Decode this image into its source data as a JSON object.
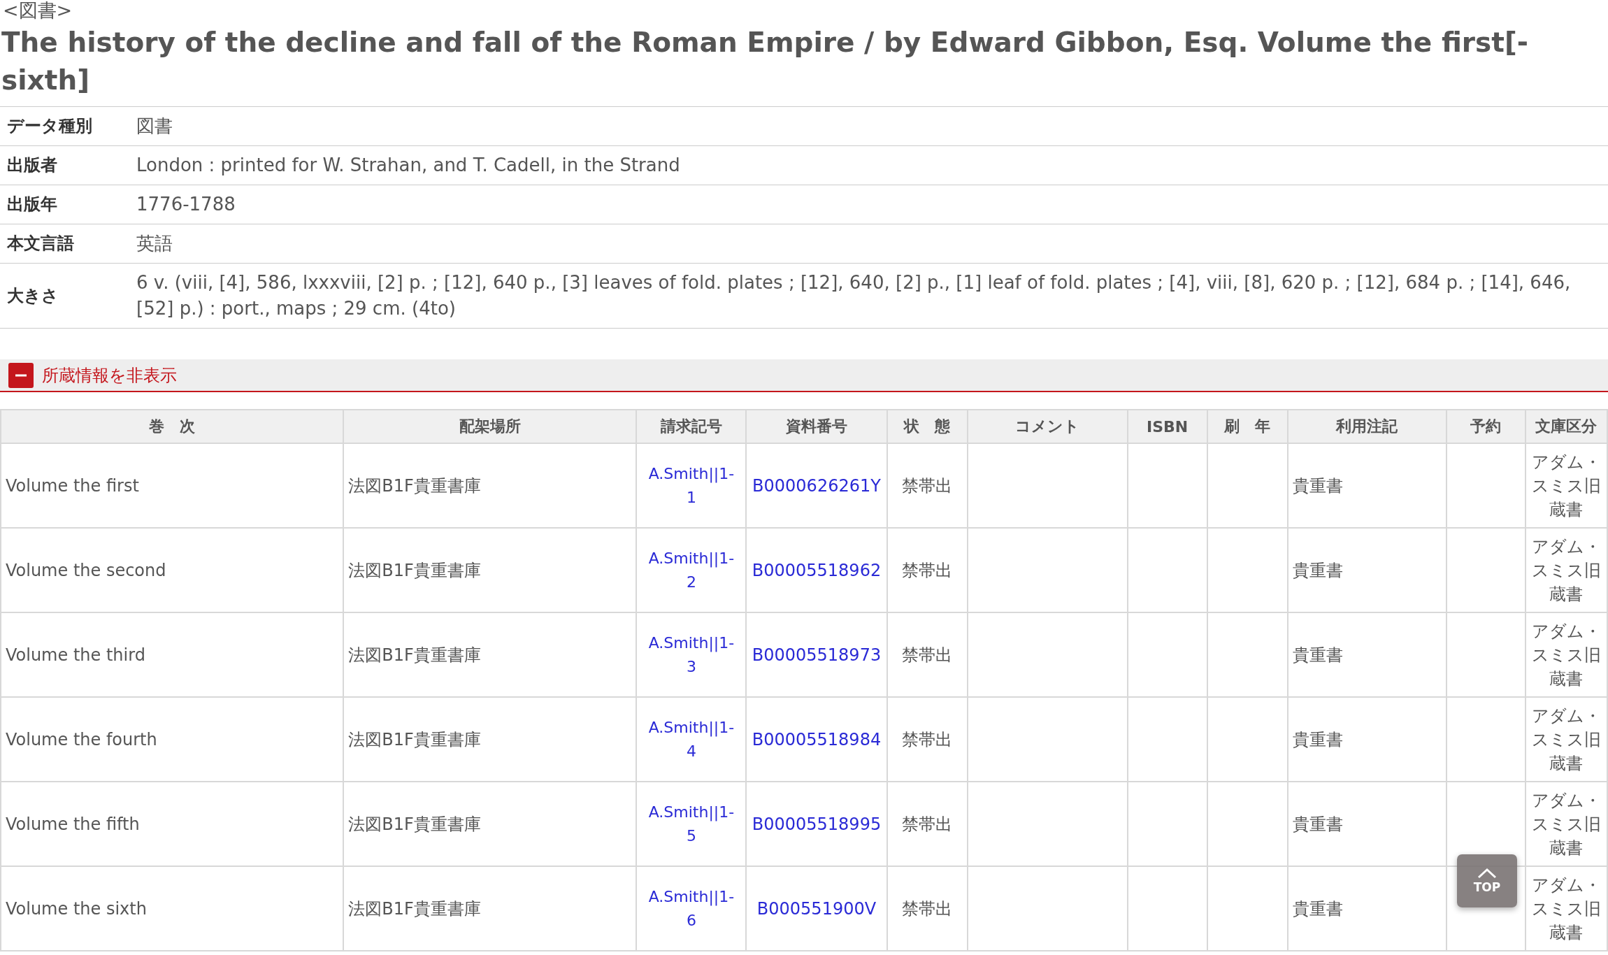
{
  "category_label": "<図書>",
  "title": "The history of the decline and fall of the Roman Empire / by Edward Gibbon, Esq. Volume the first[-sixth]",
  "details": [
    {
      "label": "データ種別",
      "value": "図書"
    },
    {
      "label": "出版者",
      "value": "London : printed for W. Strahan, and T. Cadell, in the Strand"
    },
    {
      "label": "出版年",
      "value": "1776-1788"
    },
    {
      "label": "本文言語",
      "value": "英語"
    },
    {
      "label": "大きさ",
      "value": "6 v. (viii, [4], 586, lxxxviii, [2] p. ; [12], 640 p., [3] leaves of fold. plates ; [12], 640, [2] p., [1] leaf of fold. plates ; [4], viii, [8], 620 p. ; [12], 684 p. ; [14], 646, [52] p.) : port., maps ; 29 cm. (4to)"
    }
  ],
  "holdings_toggle": {
    "label": "所蔵情報を非表示",
    "expanded": true
  },
  "holdings_table": {
    "columns": [
      "巻　次",
      "配架場所",
      "請求記号",
      "資料番号",
      "状　態",
      "コメント",
      "ISBN",
      "刷　年",
      "利用注記",
      "予約",
      "文庫区分"
    ],
    "rows": [
      {
        "volume": "Volume the first",
        "location": "法図B1F貴重書庫",
        "call_number": "A.Smith||1-1",
        "item_number": "B0000626261Y",
        "status": "禁帯出",
        "usage_note": "貴重書",
        "collection": "アダム・スミス旧蔵書"
      },
      {
        "volume": "Volume the second",
        "location": "法図B1F貴重書庫",
        "call_number": "A.Smith||1-2",
        "item_number": "B00005518962",
        "status": "禁帯出",
        "usage_note": "貴重書",
        "collection": "アダム・スミス旧蔵書"
      },
      {
        "volume": "Volume the third",
        "location": "法図B1F貴重書庫",
        "call_number": "A.Smith||1-3",
        "item_number": "B00005518973",
        "status": "禁帯出",
        "usage_note": "貴重書",
        "collection": "アダム・スミス旧蔵書"
      },
      {
        "volume": "Volume the fourth",
        "location": "法図B1F貴重書庫",
        "call_number": "A.Smith||1-4",
        "item_number": "B00005518984",
        "status": "禁帯出",
        "usage_note": "貴重書",
        "collection": "アダム・スミス旧蔵書"
      },
      {
        "volume": "Volume the fifth",
        "location": "法図B1F貴重書庫",
        "call_number": "A.Smith||1-5",
        "item_number": "B00005518995",
        "status": "禁帯出",
        "usage_note": "貴重書",
        "collection": "アダム・スミス旧蔵書"
      },
      {
        "volume": "Volume the sixth",
        "location": "法図B1F貴重書庫",
        "call_number": "A.Smith||1-6",
        "item_number": "B000551900V",
        "status": "禁帯出",
        "usage_note": "貴重書",
        "collection": "アダム・スミス旧蔵書"
      }
    ]
  },
  "top_button": {
    "label": "TOP"
  }
}
